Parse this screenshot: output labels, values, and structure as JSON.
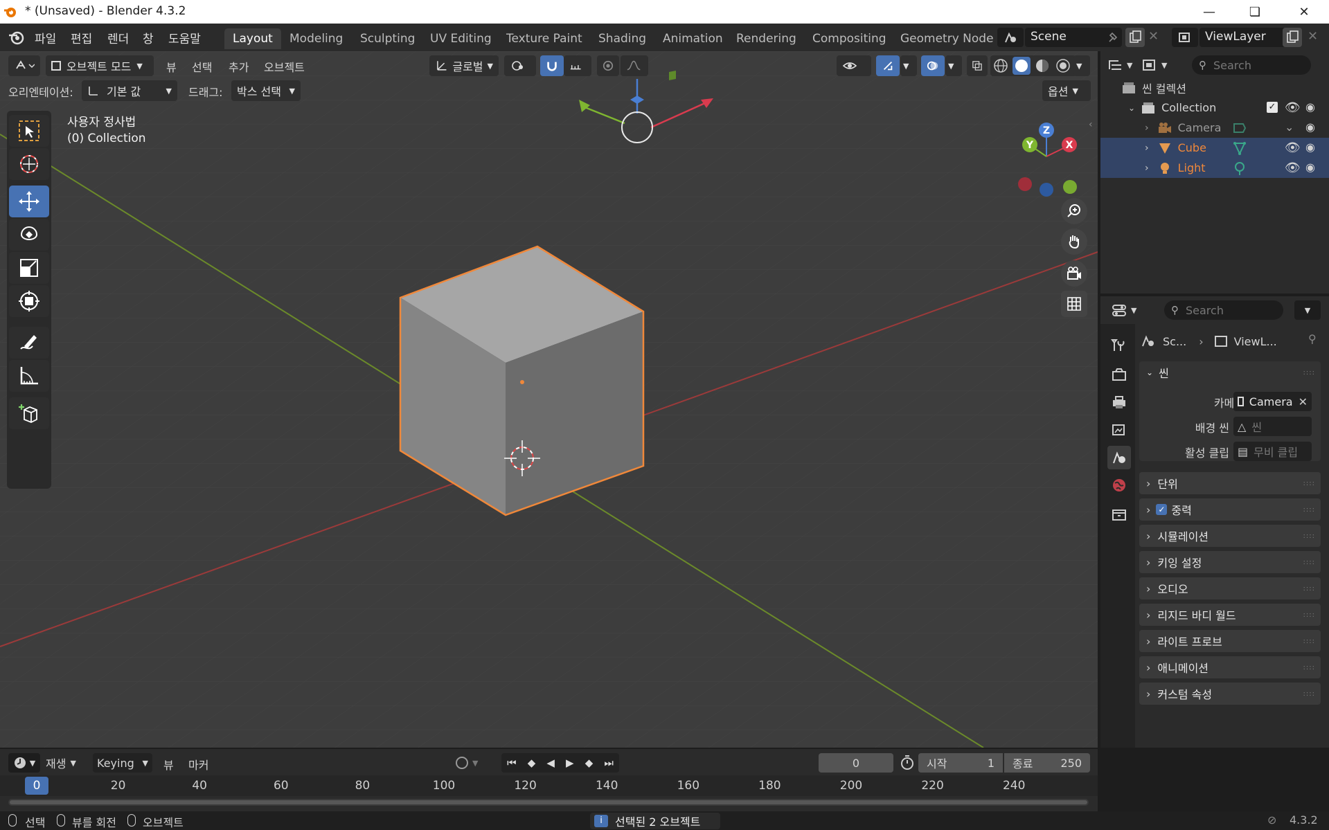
{
  "window": {
    "title": "* (Unsaved) - Blender 4.3.2"
  },
  "menus": [
    "파일",
    "편집",
    "렌더",
    "창",
    "도움말"
  ],
  "workspaces": [
    "Layout",
    "Modeling",
    "Sculpting",
    "UV Editing",
    "Texture Paint",
    "Shading",
    "Animation",
    "Rendering",
    "Compositing",
    "Geometry Node"
  ],
  "scene_field": "Scene",
  "viewlayer_field": "ViewLayer",
  "viewport": {
    "mode": "오브젝트 모드",
    "menu_view": "뷰",
    "menu_select": "선택",
    "menu_add": "추가",
    "menu_object": "오브젝트",
    "transform_orientation": "글로벌",
    "orientation_label": "오리엔테이션:",
    "orientation_value": "기본 값",
    "drag_label": "드래그:",
    "drag_value": "박스 선택",
    "options": "옵션",
    "view_name": "사용자 정사법",
    "collection_info": "(0) Collection"
  },
  "gizmo": {
    "x": "X",
    "y": "Y",
    "z": "Z"
  },
  "outliner": {
    "search_placeholder": "Search",
    "scene_collection": "씬 컬렉션",
    "items": [
      {
        "label": "Collection",
        "color": "#e6e6e6"
      },
      {
        "label": "Camera",
        "color": "#9a9a9a"
      },
      {
        "label": "Cube",
        "color": "#f0883a"
      },
      {
        "label": "Light",
        "color": "#f0883a"
      }
    ]
  },
  "properties": {
    "search_placeholder": "Search",
    "breadcrumb_scene": "Sc...",
    "breadcrumb_viewlayer": "ViewL...",
    "panel_title": "씬",
    "camera_label": "카메라",
    "camera_value": "Camera",
    "background_label": "배경 씬",
    "background_placeholder": "씬",
    "clip_label": "활성 클립",
    "clip_placeholder": "무비 클립",
    "sections": [
      "단위",
      "중력",
      "시뮬레이션",
      "키잉 설정",
      "오디오",
      "리지드 바디 월드",
      "라이트 프로브",
      "애니메이션",
      "커스텀 속성"
    ],
    "gravity_checked": true
  },
  "timeline": {
    "playback": "재생",
    "keying": "Keying",
    "view": "뷰",
    "marker": "마커",
    "current_frame": "0",
    "start_label": "시작",
    "start_value": "1",
    "end_label": "종료",
    "end_value": "250",
    "ticks": [
      "0",
      "20",
      "40",
      "60",
      "80",
      "100",
      "120",
      "140",
      "160",
      "180",
      "200",
      "220",
      "240"
    ]
  },
  "statusbar": {
    "select": "선택",
    "rotate_view": "뷰를 회전",
    "object": "오브젝트",
    "message": "선택된 2 오브젝트",
    "version": "4.3.2"
  },
  "colors": {
    "accent": "#4772b3",
    "selection": "#f0883a",
    "viewport_bg": "#3d3d3d"
  }
}
